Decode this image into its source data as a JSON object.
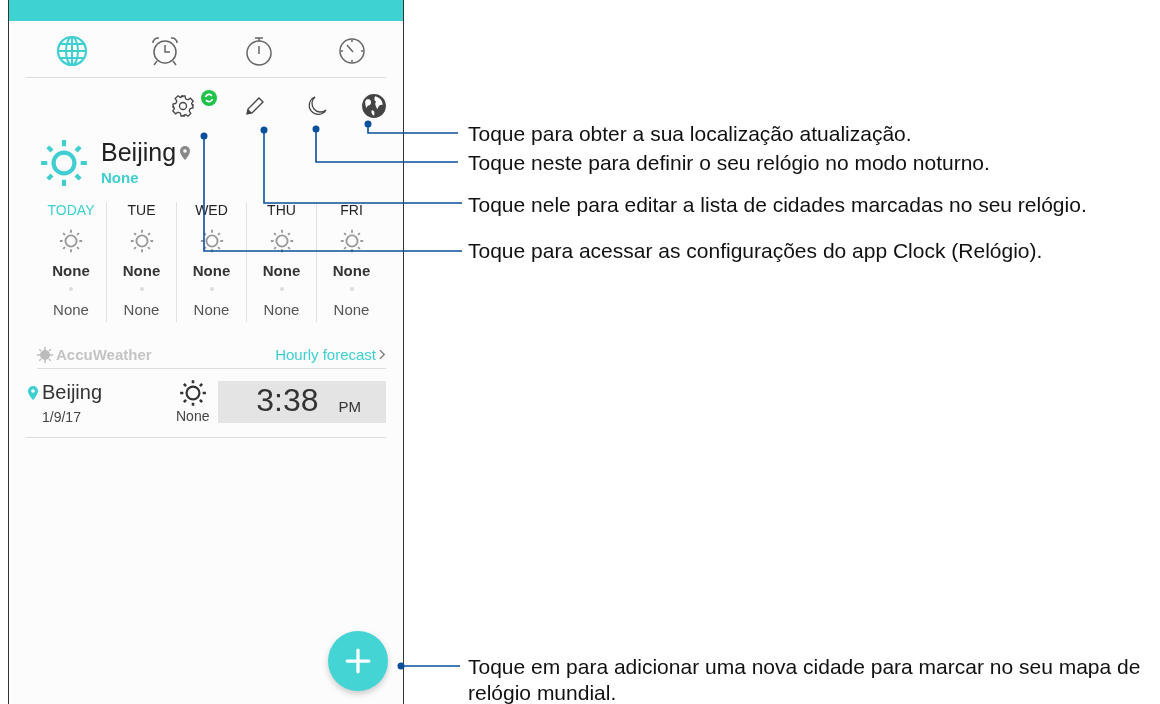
{
  "tabs": [
    {
      "kind": "world",
      "selected": true
    },
    {
      "kind": "alarm",
      "selected": false
    },
    {
      "kind": "stopwatch",
      "selected": false
    },
    {
      "kind": "timer",
      "selected": false
    }
  ],
  "current": {
    "city": "Beijing",
    "condition": "None"
  },
  "forecast": [
    {
      "day": "TODAY",
      "selected": true,
      "high": "None",
      "low": "None"
    },
    {
      "day": "TUE",
      "selected": false,
      "high": "None",
      "low": "None"
    },
    {
      "day": "WED",
      "selected": false,
      "high": "None",
      "low": "None"
    },
    {
      "day": "THU",
      "selected": false,
      "high": "None",
      "low": "None"
    },
    {
      "day": "FRI",
      "selected": false,
      "high": "None",
      "low": "None"
    }
  ],
  "provider": "AccuWeather",
  "hourly_link": "Hourly forecast",
  "city_row": {
    "city": "Beijing",
    "date": "1/9/17",
    "condition": "None",
    "time": "3:38",
    "ampm": "PM"
  },
  "callouts": [
    {
      "kind": "location",
      "text": "Toque para obter a sua localização atualização."
    },
    {
      "kind": "night",
      "text": "Toque neste para definir o seu relógio no modo noturno."
    },
    {
      "kind": "edit",
      "text": "Toque nele para editar a lista de cidades marcadas no seu relógio."
    },
    {
      "kind": "settings",
      "text": "Toque para acessar as configurações do app Clock (Relógio)."
    },
    {
      "kind": "add",
      "text": "Toque em para adicionar uma nova cidade para marcar no seu mapa de relógio mundial."
    }
  ]
}
